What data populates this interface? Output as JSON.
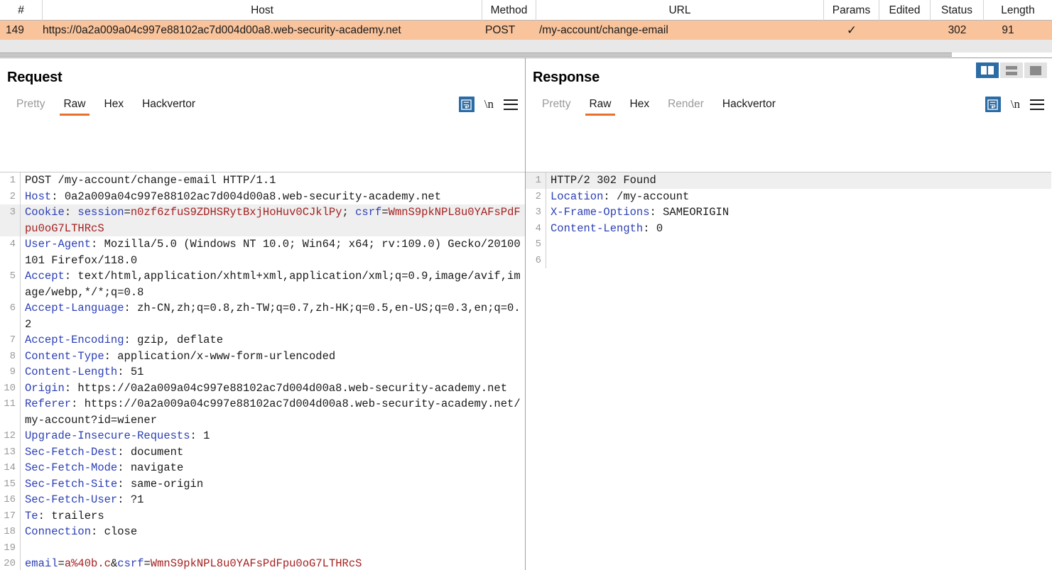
{
  "table": {
    "columns": [
      "#",
      "Host",
      "Method",
      "URL",
      "Params",
      "Edited",
      "Status",
      "Length"
    ],
    "rows": [
      {
        "num": "149",
        "host": "https://0a2a009a04c997e88102ac7d004d00a8.web-security-academy.net",
        "method": "POST",
        "url": "/my-account/change-email",
        "params": "✓",
        "edited": "",
        "status": "302",
        "length": "91",
        "selected": true,
        "highlight_color": "#f9c39b"
      }
    ]
  },
  "request": {
    "title": "Request",
    "tabs": [
      {
        "label": "Pretty",
        "state": "dim"
      },
      {
        "label": "Raw",
        "state": "active"
      },
      {
        "label": "Hex",
        "state": "enabled"
      },
      {
        "label": "Hackvertor",
        "state": "enabled"
      }
    ],
    "tools": {
      "wrap_icon": "word-wrap-icon",
      "newline_label": "\\n",
      "menu_icon": "hamburger-menu-icon"
    },
    "lines": [
      {
        "n": "1",
        "hl": false,
        "parts": [
          {
            "t": "POST /my-account/change-email HTTP/1.1",
            "c": "k-val"
          }
        ]
      },
      {
        "n": "2",
        "hl": false,
        "parts": [
          {
            "t": "Host",
            "c": "k-hdr"
          },
          {
            "t": ": 0a2a009a04c997e88102ac7d004d00a8.web-security-academy.net",
            "c": "k-val"
          }
        ]
      },
      {
        "n": "3",
        "hl": true,
        "parts": [
          {
            "t": "Cookie",
            "c": "k-hdr"
          },
          {
            "t": ": ",
            "c": "k-val"
          },
          {
            "t": "session",
            "c": "k-blue"
          },
          {
            "t": "=",
            "c": "k-val"
          },
          {
            "t": "n0zf6zfuS9ZDHSRytBxjHoHuv0CJklPy",
            "c": "k-red"
          },
          {
            "t": "; ",
            "c": "k-val"
          },
          {
            "t": "csrf",
            "c": "k-blue"
          },
          {
            "t": "=",
            "c": "k-val"
          },
          {
            "t": "WmnS9pkNPL8u0YAFsPdFpu0oG7LTHRcS",
            "c": "k-red"
          }
        ]
      },
      {
        "n": "4",
        "hl": false,
        "parts": [
          {
            "t": "User-Agent",
            "c": "k-hdr"
          },
          {
            "t": ": Mozilla/5.0 (Windows NT 10.0; Win64; x64; rv:109.0) Gecko/20100101 Firefox/118.0",
            "c": "k-val"
          }
        ]
      },
      {
        "n": "5",
        "hl": false,
        "parts": [
          {
            "t": "Accept",
            "c": "k-hdr"
          },
          {
            "t": ": text/html,application/xhtml+xml,application/xml;q=0.9,image/avif,image/webp,*/*;q=0.8",
            "c": "k-val"
          }
        ]
      },
      {
        "n": "6",
        "hl": false,
        "parts": [
          {
            "t": "Accept-Language",
            "c": "k-hdr"
          },
          {
            "t": ": zh-CN,zh;q=0.8,zh-TW;q=0.7,zh-HK;q=0.5,en-US;q=0.3,en;q=0.2",
            "c": "k-val"
          }
        ]
      },
      {
        "n": "7",
        "hl": false,
        "parts": [
          {
            "t": "Accept-Encoding",
            "c": "k-hdr"
          },
          {
            "t": ": gzip, deflate",
            "c": "k-val"
          }
        ]
      },
      {
        "n": "8",
        "hl": false,
        "parts": [
          {
            "t": "Content-Type",
            "c": "k-hdr"
          },
          {
            "t": ": application/x-www-form-urlencoded",
            "c": "k-val"
          }
        ]
      },
      {
        "n": "9",
        "hl": false,
        "parts": [
          {
            "t": "Content-Length",
            "c": "k-hdr"
          },
          {
            "t": ": 51",
            "c": "k-val"
          }
        ]
      },
      {
        "n": "10",
        "hl": false,
        "parts": [
          {
            "t": "Origin",
            "c": "k-hdr"
          },
          {
            "t": ": https://0a2a009a04c997e88102ac7d004d00a8.web-security-academy.net",
            "c": "k-val"
          }
        ]
      },
      {
        "n": "11",
        "hl": false,
        "parts": [
          {
            "t": "Referer",
            "c": "k-hdr"
          },
          {
            "t": ": https://0a2a009a04c997e88102ac7d004d00a8.web-security-academy.net/my-account?id=wiener",
            "c": "k-val"
          }
        ]
      },
      {
        "n": "12",
        "hl": false,
        "parts": [
          {
            "t": "Upgrade-Insecure-Requests",
            "c": "k-hdr"
          },
          {
            "t": ": 1",
            "c": "k-val"
          }
        ]
      },
      {
        "n": "13",
        "hl": false,
        "parts": [
          {
            "t": "Sec-Fetch-Dest",
            "c": "k-hdr"
          },
          {
            "t": ": document",
            "c": "k-val"
          }
        ]
      },
      {
        "n": "14",
        "hl": false,
        "parts": [
          {
            "t": "Sec-Fetch-Mode",
            "c": "k-hdr"
          },
          {
            "t": ": navigate",
            "c": "k-val"
          }
        ]
      },
      {
        "n": "15",
        "hl": false,
        "parts": [
          {
            "t": "Sec-Fetch-Site",
            "c": "k-hdr"
          },
          {
            "t": ": same-origin",
            "c": "k-val"
          }
        ]
      },
      {
        "n": "16",
        "hl": false,
        "parts": [
          {
            "t": "Sec-Fetch-User",
            "c": "k-hdr"
          },
          {
            "t": ": ?1",
            "c": "k-val"
          }
        ]
      },
      {
        "n": "17",
        "hl": false,
        "parts": [
          {
            "t": "Te",
            "c": "k-hdr"
          },
          {
            "t": ": trailers",
            "c": "k-val"
          }
        ]
      },
      {
        "n": "18",
        "hl": false,
        "parts": [
          {
            "t": "Connection",
            "c": "k-hdr"
          },
          {
            "t": ": close",
            "c": "k-val"
          }
        ]
      },
      {
        "n": "19",
        "hl": false,
        "parts": [
          {
            "t": "",
            "c": "k-val"
          }
        ]
      },
      {
        "n": "20",
        "hl": false,
        "parts": [
          {
            "t": "email",
            "c": "k-blue"
          },
          {
            "t": "=",
            "c": "k-val"
          },
          {
            "t": "a%40b.c",
            "c": "k-red"
          },
          {
            "t": "&",
            "c": "k-val"
          },
          {
            "t": "csrf",
            "c": "k-blue"
          },
          {
            "t": "=",
            "c": "k-val"
          },
          {
            "t": "WmnS9pkNPL8u0YAFsPdFpu0oG7LTHRcS",
            "c": "k-red"
          }
        ]
      }
    ]
  },
  "response": {
    "title": "Response",
    "tabs": [
      {
        "label": "Pretty",
        "state": "dim"
      },
      {
        "label": "Raw",
        "state": "active"
      },
      {
        "label": "Hex",
        "state": "enabled"
      },
      {
        "label": "Render",
        "state": "dim"
      },
      {
        "label": "Hackvertor",
        "state": "enabled"
      }
    ],
    "tools": {
      "wrap_icon": "word-wrap-icon",
      "newline_label": "\\n",
      "menu_icon": "hamburger-menu-icon"
    },
    "layout_toggle": [
      {
        "name": "vertical-split-layout",
        "active": true
      },
      {
        "name": "horizontal-split-layout",
        "active": false
      },
      {
        "name": "single-pane-layout",
        "active": false
      }
    ],
    "lines": [
      {
        "n": "1",
        "hl": true,
        "parts": [
          {
            "t": "HTTP/2 302 Found",
            "c": "k-val"
          }
        ]
      },
      {
        "n": "2",
        "hl": false,
        "parts": [
          {
            "t": "Location",
            "c": "k-hdr"
          },
          {
            "t": ": /my-account",
            "c": "k-val"
          }
        ]
      },
      {
        "n": "3",
        "hl": false,
        "parts": [
          {
            "t": "X-Frame-Options",
            "c": "k-hdr"
          },
          {
            "t": ": SAMEORIGIN",
            "c": "k-val"
          }
        ]
      },
      {
        "n": "4",
        "hl": false,
        "parts": [
          {
            "t": "Content-Length",
            "c": "k-hdr"
          },
          {
            "t": ": 0",
            "c": "k-val"
          }
        ]
      },
      {
        "n": "5",
        "hl": false,
        "parts": [
          {
            "t": "",
            "c": "k-val"
          }
        ]
      },
      {
        "n": "6",
        "hl": false,
        "parts": [
          {
            "t": "",
            "c": "k-val"
          }
        ]
      }
    ]
  },
  "colors": {
    "accent_tab": "#e8712b",
    "selected_row": "#f9c39b",
    "header_key": "#2b3fb5",
    "value_red": "#a52020",
    "toolbar_blue": "#2c6ca5"
  }
}
